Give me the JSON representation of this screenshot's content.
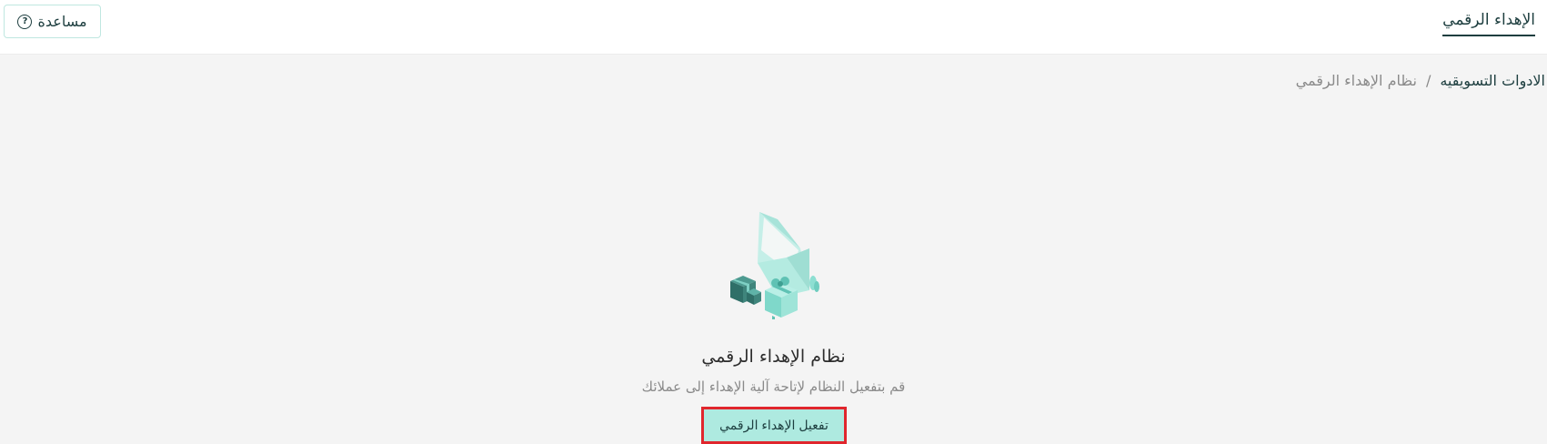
{
  "header": {
    "page_tab": "الإهداء الرقمي",
    "help_label": "مساعدة",
    "help_icon": "question-circle-icon"
  },
  "breadcrumb": {
    "parent": "الادوات التسويقيه",
    "separator": "/",
    "current": "نظام الإهداء الرقمي"
  },
  "empty_state": {
    "illustration": "gift-envelope-illustration",
    "title": "نظام الإهداء الرقمي",
    "description": "قم بتفعيل النظام لإتاحة آلية الإهداء إلى عملائك",
    "button_label": "تفعيل الإهداء الرقمي"
  },
  "colors": {
    "accent": "#aeeae0",
    "text_dark": "#1d3e3f",
    "highlight_border": "#e0262d",
    "background": "#f4f4f4"
  }
}
